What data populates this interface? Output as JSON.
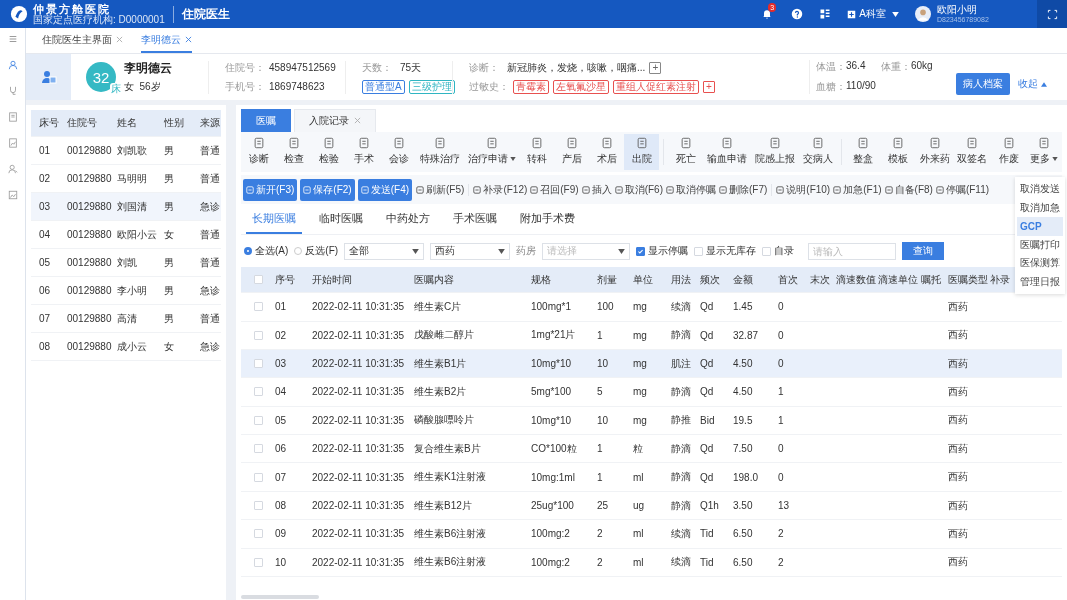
{
  "header": {
    "hospital": "仲景方舱医院",
    "institution": "国家定点医疗机构: D0000001",
    "module": "住院医生",
    "notifications": "3",
    "department": "A科室",
    "user_name": "欧阳小明",
    "user_id": "D823456789082"
  },
  "page_tabs": [
    {
      "label": "住院医生主界面",
      "selected": false
    },
    {
      "label": "李明德云",
      "selected": true
    }
  ],
  "patient": {
    "bed": "32",
    "bed_unit": "床",
    "name": "李明德云",
    "sex_age": "女  56岁",
    "admission_label": "住院号：",
    "admission_no": "458947512569",
    "phone_label": "手机号：",
    "phone": "1869748623",
    "days_label": "天数：",
    "days": "75天",
    "care_tags": [
      {
        "label": "普通型A",
        "color": "#3a7ee0"
      },
      {
        "label": "三级护理",
        "color": "#2fb5c2"
      }
    ],
    "diagnosis_label": "诊断：",
    "diagnosis": "新冠肺炎，发烧，咳嗽，咽痛...",
    "add": "+",
    "allergy_label": "过敏史：",
    "allergies": [
      {
        "label": "青霉素",
        "color": "#e8504f"
      },
      {
        "label": "左氧氟沙星",
        "color": "#e8504f"
      },
      {
        "label": "重组人促红素注射",
        "color": "#e8504f"
      }
    ],
    "vitals": [
      {
        "label": "体温：",
        "value": "36.4"
      },
      {
        "label": "体重：",
        "value": "60kg"
      },
      {
        "label": "血糖：",
        "value": "110/90"
      }
    ],
    "record_button": "病人档案",
    "collapse": "收起"
  },
  "patient_list": {
    "columns": [
      "床号",
      "住院号",
      "姓名",
      "性别",
      "来源"
    ],
    "rows": [
      {
        "cells": [
          "01",
          "00129880",
          "刘凯歌",
          "男",
          "普通"
        ],
        "selected": false
      },
      {
        "cells": [
          "02",
          "00129880",
          "马明明",
          "男",
          "普通"
        ],
        "selected": false
      },
      {
        "cells": [
          "03",
          "00129880",
          "刘国清",
          "男",
          "急诊"
        ],
        "selected": true
      },
      {
        "cells": [
          "04",
          "00129880",
          "欧阳小云",
          "女",
          "普通"
        ],
        "selected": false
      },
      {
        "cells": [
          "05",
          "00129880",
          "刘凯",
          "男",
          "普通"
        ],
        "selected": false
      },
      {
        "cells": [
          "06",
          "00129880",
          "李小明",
          "男",
          "急诊"
        ],
        "selected": false
      },
      {
        "cells": [
          "07",
          "00129880",
          "高清",
          "男",
          "普通"
        ],
        "selected": false
      },
      {
        "cells": [
          "08",
          "00129880",
          "成小云",
          "女",
          "急诊"
        ],
        "selected": false
      }
    ]
  },
  "section_tabs": [
    {
      "label": "医嘱",
      "selected": true,
      "closable": false
    },
    {
      "label": "入院记录",
      "selected": false,
      "closable": true
    }
  ],
  "toolbar": [
    [
      {
        "label": "诊断",
        "selected": false
      },
      {
        "label": "检查",
        "selected": false
      },
      {
        "label": "检验",
        "selected": false
      },
      {
        "label": "手术",
        "selected": false
      },
      {
        "label": "会诊",
        "selected": false
      },
      {
        "label": "特殊治疗",
        "selected": false
      },
      {
        "label": "治疗申请",
        "selected": false,
        "dropdown": true
      },
      {
        "label": "转科",
        "selected": false
      },
      {
        "label": "产后",
        "selected": false
      },
      {
        "label": "术后",
        "selected": false
      },
      {
        "label": "出院",
        "selected": true
      }
    ],
    [
      {
        "label": "死亡",
        "selected": false
      },
      {
        "label": "输血申请",
        "selected": false
      },
      {
        "label": "院感上报",
        "selected": false
      },
      {
        "label": "交病人",
        "selected": false
      }
    ],
    [
      {
        "label": "整盒",
        "selected": false
      },
      {
        "label": "模板",
        "selected": false
      },
      {
        "label": "外来药",
        "selected": false
      },
      {
        "label": "双签名",
        "selected": false
      },
      {
        "label": "作废",
        "selected": false
      },
      {
        "label": "更多",
        "selected": false,
        "dropdown": true
      }
    ]
  ],
  "actions": [
    [
      {
        "label": "新开(F3)",
        "kind": "primary"
      },
      {
        "label": "保存(F2)",
        "kind": "primary"
      },
      {
        "label": "发送(F4)",
        "kind": "primary"
      },
      {
        "label": "刷新(F5)",
        "kind": "plain"
      }
    ],
    [
      {
        "label": "补录(F12)",
        "kind": "plain"
      },
      {
        "label": "召回(F9)",
        "kind": "plain"
      },
      {
        "label": "插入",
        "kind": "plain"
      },
      {
        "label": "取消(F6)",
        "kind": "plain"
      },
      {
        "label": "取消停嘱",
        "kind": "plain"
      },
      {
        "label": "删除(F7)",
        "kind": "plain"
      }
    ],
    [
      {
        "label": "说明(F10)",
        "kind": "plain"
      },
      {
        "label": "加急(F1)",
        "kind": "plain"
      },
      {
        "label": "自备(F8)",
        "kind": "plain"
      },
      {
        "label": "停嘱(F11)",
        "kind": "plain"
      }
    ]
  ],
  "more_menu": [
    {
      "label": "取消发送",
      "selected": false
    },
    {
      "label": "取消加急",
      "selected": false
    },
    {
      "label": "GCP",
      "selected": true
    },
    {
      "label": "医嘱打印",
      "selected": false
    },
    {
      "label": "医保测算",
      "selected": false
    },
    {
      "label": "管理日报",
      "selected": false
    }
  ],
  "order_tabs": [
    {
      "label": "长期医嘱",
      "selected": true
    },
    {
      "label": "临时医嘱",
      "selected": false
    },
    {
      "label": "中药处方",
      "selected": false
    },
    {
      "label": "手术医嘱",
      "selected": false
    },
    {
      "label": "附加手术费",
      "selected": false
    }
  ],
  "filters": {
    "radios": [
      {
        "label": "全选(A)",
        "selected": true
      },
      {
        "label": "反选(F)",
        "selected": false
      }
    ],
    "type_select": "全部",
    "drug_select": "西药",
    "pharmacy_label": "药房",
    "pharmacy_placeholder": "请选择",
    "checks": [
      {
        "label": "显示停嘱",
        "checked": true
      },
      {
        "label": "显示无库存",
        "checked": false
      },
      {
        "label": "自录",
        "checked": false
      }
    ],
    "search_placeholder": "请输入",
    "query_button": "查询"
  },
  "orders": {
    "select_all_checked": false,
    "columns": [
      "序号",
      "开始时间",
      "医嘱内容",
      "规格",
      "剂量",
      "单位",
      "用法",
      "频次",
      "金额",
      "首次",
      "末次",
      "滴速数值",
      "滴速单位",
      "嘱托",
      "医嘱类型",
      "补录"
    ],
    "rows": [
      {
        "cells": [
          "01",
          "2022-02-11 10:31:35",
          "维生素C片",
          "100mg*1",
          "100",
          "mg",
          "续滴",
          "Qd",
          "1.45",
          "0",
          "",
          "",
          "",
          "",
          "西药",
          ""
        ],
        "selected": false
      },
      {
        "cells": [
          "02",
          "2022-02-11 10:31:35",
          "戊酸雌二醇片",
          "1mg*21片",
          "1",
          "mg",
          "静滴",
          "Qd",
          "32.87",
          "0",
          "",
          "",
          "",
          "",
          "西药",
          ""
        ],
        "selected": false
      },
      {
        "cells": [
          "03",
          "2022-02-11 10:31:35",
          "维生素B1片",
          "10mg*10",
          "10",
          "mg",
          "肌注",
          "Qd",
          "4.50",
          "0",
          "",
          "",
          "",
          "",
          "西药",
          ""
        ],
        "selected": true
      },
      {
        "cells": [
          "04",
          "2022-02-11 10:31:35",
          "维生素B2片",
          "5mg*100",
          "5",
          "mg",
          "静滴",
          "Qd",
          "4.50",
          "1",
          "",
          "",
          "",
          "",
          "西药",
          ""
        ],
        "selected": false
      },
      {
        "cells": [
          "05",
          "2022-02-11 10:31:35",
          "磷酸腺嘌呤片",
          "10mg*10",
          "10",
          "mg",
          "静推",
          "Bid",
          "19.5",
          "1",
          "",
          "",
          "",
          "",
          "西药",
          ""
        ],
        "selected": false
      },
      {
        "cells": [
          "06",
          "2022-02-11 10:31:35",
          "复合维生素B片",
          "CO*100粒",
          "1",
          "粒",
          "静滴",
          "Qd",
          "7.50",
          "0",
          "",
          "",
          "",
          "",
          "西药",
          ""
        ],
        "selected": false
      },
      {
        "cells": [
          "07",
          "2022-02-11 10:31:35",
          "维生素K1注射液",
          "10mg:1ml",
          "1",
          "ml",
          "静滴",
          "Qd",
          "198.0",
          "0",
          "",
          "",
          "",
          "",
          "西药",
          ""
        ],
        "selected": false
      },
      {
        "cells": [
          "08",
          "2022-02-11 10:31:35",
          "维生素B12片",
          "25ug*100",
          "25",
          "ug",
          "静滴",
          "Q1h",
          "3.50",
          "13",
          "",
          "",
          "",
          "",
          "西药",
          ""
        ],
        "selected": false
      },
      {
        "cells": [
          "09",
          "2022-02-11 10:31:35",
          "维生素B6注射液",
          "100mg:2",
          "2",
          "ml",
          "续滴",
          "Tid",
          "6.50",
          "2",
          "",
          "",
          "",
          "",
          "西药",
          ""
        ],
        "selected": false
      },
      {
        "cells": [
          "10",
          "2022-02-11 10:31:35",
          "维生素B6注射液",
          "100mg:2",
          "2",
          "ml",
          "续滴",
          "Tid",
          "6.50",
          "2",
          "",
          "",
          "",
          "",
          "西药",
          ""
        ],
        "selected": false
      }
    ]
  }
}
